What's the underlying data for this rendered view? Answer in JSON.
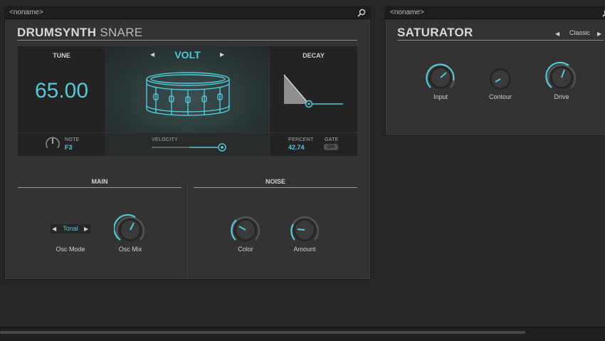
{
  "drumsynth": {
    "preset_name": "<noname>",
    "title_bold": "DRUMSYNTH",
    "title_thin": "SNARE",
    "tune": {
      "label": "TUNE",
      "value": "65.00"
    },
    "engine": {
      "name": "VOLT"
    },
    "decay": {
      "label": "DECAY",
      "level": 0.42
    },
    "note": {
      "label": "NOTE",
      "value": "F3"
    },
    "velocity": {
      "label": "VELOCITY",
      "level": 0.88
    },
    "percent": {
      "label": "PERCENT",
      "value": "42.74"
    },
    "gate": {
      "label": "GATE",
      "value": "ON"
    },
    "main": {
      "heading": "MAIN",
      "osc_mode": {
        "value": "Tonal",
        "label": "Osc Mode"
      },
      "osc_mix": {
        "label": "Osc Mix",
        "level": 0.55
      }
    },
    "noise": {
      "heading": "NOISE",
      "color": {
        "label": "Color",
        "level": 0.25
      },
      "amount": {
        "label": "Amount",
        "level": 0.3
      }
    }
  },
  "saturator": {
    "preset_name": "<noname>",
    "title": "SATURATOR",
    "mode": "Classic",
    "input": {
      "label": "Input",
      "level": 0.75
    },
    "contour": {
      "label": "Contour",
      "level": 0.3
    },
    "drive": {
      "label": "Drive",
      "level": 0.6
    }
  },
  "colors": {
    "accent": "#55c8d6",
    "panel": "#333333",
    "background": "#262626"
  }
}
